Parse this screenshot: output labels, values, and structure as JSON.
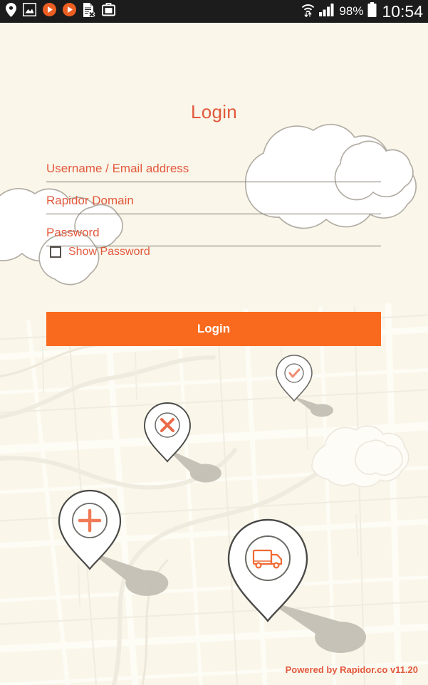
{
  "status_bar": {
    "icons_left": [
      "location-pin-icon",
      "image-icon",
      "play-circle-icon",
      "play-circle-icon",
      "document-error-icon",
      "briefcase-icon"
    ],
    "icons_right": [
      "wifi-transfer-icon",
      "cellular-signal-icon",
      "battery-icon"
    ],
    "battery_percent": "98%",
    "clock": "10:54"
  },
  "login": {
    "title": "Login",
    "fields": [
      {
        "name": "username",
        "label": "Username / Email address",
        "value": "",
        "placeholder": "Username / Email address"
      },
      {
        "name": "domain",
        "label": "Rapidor Domain",
        "value": "",
        "placeholder": "Rapidor Domain"
      },
      {
        "name": "password",
        "label": "Password",
        "value": "",
        "placeholder": "Password"
      }
    ],
    "show_password_label": "Show Password",
    "show_password_checked": false,
    "submit_label": "Login"
  },
  "footer": {
    "text": "Powered by Rapidor.co v11.20"
  },
  "map": {
    "pins": [
      {
        "name": "pin-check",
        "icon": "check-icon"
      },
      {
        "name": "pin-cancel",
        "icon": "cross-icon"
      },
      {
        "name": "pin-add",
        "icon": "plus-icon"
      },
      {
        "name": "pin-delivery",
        "icon": "truck-icon"
      }
    ]
  },
  "colors": {
    "background": "#faf6ea",
    "accent": "#e2593c",
    "button": "#f96a1e",
    "status_bar": "#1c1c1c",
    "field_line": "#7c7468",
    "cloud_stroke": "#b3aea5",
    "pin_stroke": "#4a4a48"
  }
}
